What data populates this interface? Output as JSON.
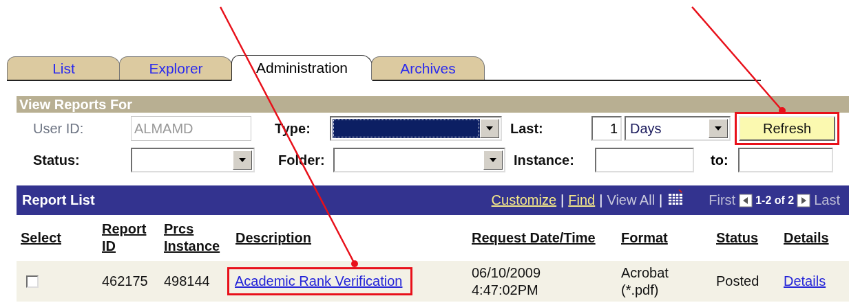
{
  "tabs": [
    {
      "label": "List",
      "selected": false
    },
    {
      "label": "Explorer",
      "selected": false
    },
    {
      "label": "Administration",
      "selected": true
    },
    {
      "label": "Archives",
      "selected": false
    }
  ],
  "filters": {
    "title": "View Reports For",
    "rows": [
      [
        {
          "label": "User ID:",
          "disabled": true,
          "controls": [
            {
              "kind": "text",
              "value": "ALMAMD",
              "disabled": true
            }
          ]
        },
        {
          "label": "Type:",
          "disabled": false,
          "controls": [
            {
              "kind": "select",
              "focused": true
            }
          ]
        },
        {
          "label": "Last:",
          "disabled": false,
          "controls": [
            {
              "kind": "number",
              "value": "1"
            },
            {
              "kind": "select",
              "value": "Days",
              "focused": false
            },
            {
              "kind": "button",
              "label": "Refresh",
              "highlighted": true
            }
          ]
        }
      ],
      [
        {
          "label": "Status:",
          "disabled": false,
          "controls": [
            {
              "kind": "select",
              "focused": false
            }
          ]
        },
        {
          "label": "Folder:",
          "disabled": false,
          "controls": [
            {
              "kind": "select",
              "focused": false
            }
          ]
        },
        {
          "label": "Instance:",
          "disabled": false,
          "controls": [
            {
              "kind": "text",
              "disabled": false
            },
            {
              "kind": "label",
              "label": "to:"
            },
            {
              "kind": "text",
              "disabled": false
            }
          ]
        }
      ]
    ]
  },
  "report_list": {
    "title": "Report List",
    "toolbar": [
      {
        "kind": "link",
        "label": "Customize",
        "enabled": true
      },
      {
        "kind": "separator",
        "label": "|"
      },
      {
        "kind": "link",
        "label": "Find",
        "enabled": true
      },
      {
        "kind": "separator",
        "label": "|"
      },
      {
        "kind": "link",
        "label": "View All",
        "enabled": false
      },
      {
        "kind": "separator",
        "label": "|"
      },
      {
        "kind": "grid"
      }
    ],
    "pager": {
      "first": "First",
      "range": "1-2 of 2",
      "last": "Last"
    },
    "columns": [
      "Select",
      "Report ID",
      "Prcs Instance",
      "Description",
      "Request Date/Time",
      "Format",
      "Status",
      "Details"
    ],
    "rows": [
      {
        "checked": false,
        "report_id": "462175",
        "prcs_instance": "498144",
        "description": "Academic Rank Verification",
        "description_highlighted": true,
        "request_date": "06/10/2009 4:47:02PM",
        "format": "Acrobat (*.pdf)",
        "status": "Posted",
        "details": "Details"
      }
    ]
  }
}
